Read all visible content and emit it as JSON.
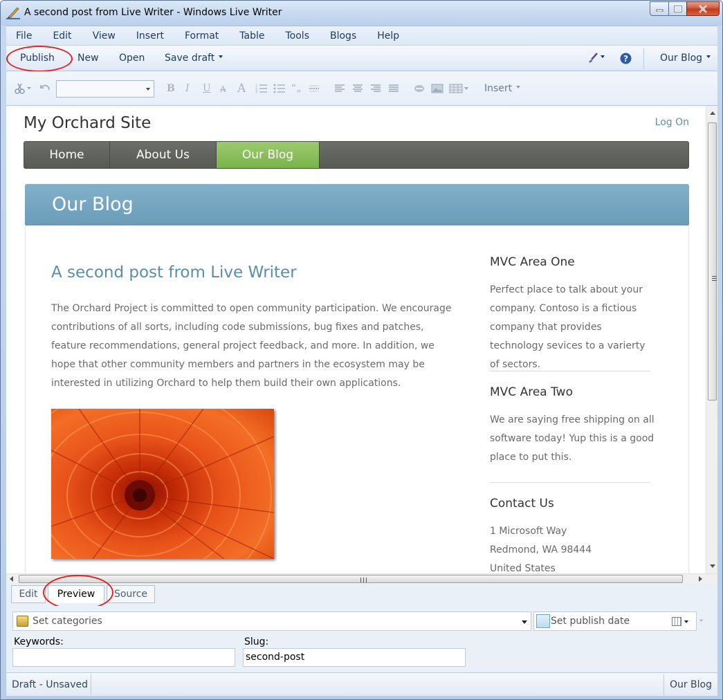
{
  "window": {
    "title": "A second post from Live Writer - Windows Live Writer"
  },
  "menu": {
    "items": [
      "File",
      "Edit",
      "View",
      "Insert",
      "Format",
      "Table",
      "Tools",
      "Blogs",
      "Help"
    ]
  },
  "commands": {
    "publish": "Publish",
    "new": "New",
    "open": "Open",
    "save_draft": "Save draft",
    "blog_selector": "Our Blog"
  },
  "format_toolbar": {
    "insert_label": "Insert",
    "font_value": ""
  },
  "site": {
    "title": "My Orchard Site",
    "log_on": "Log On",
    "nav": [
      {
        "label": "Home",
        "active": false
      },
      {
        "label": "About Us",
        "active": false
      },
      {
        "label": "Our Blog",
        "active": true
      }
    ],
    "banner": "Our Blog"
  },
  "post": {
    "title": "A second post from Live Writer",
    "body": "The Orchard Project is committed to open community participation. We encourage contributions of all sorts, including code submissions, bug fixes and patches, feature recommendations, general project feedback, and more. In addition, we hope that other community members and partners in the ecosystem may be interested in utilizing Orchard to help them build their own applications.",
    "image": "orange chrysanthemum flower"
  },
  "sidebar": [
    {
      "heading": "MVC Area One",
      "text": "Perfect place to talk about your company. Contoso is a fictious company that provides technology sevices to a varierty of sectors."
    },
    {
      "heading": "MVC Area Two",
      "text": "We are saying free shipping on all software today! Yup this is a good place to put this."
    },
    {
      "heading": "Contact Us",
      "lines": [
        "1 Microsoft Way",
        "Redmond, WA 98444",
        "United States"
      ]
    }
  ],
  "view_tabs": [
    {
      "label": "Edit",
      "active": false
    },
    {
      "label": "Preview",
      "active": true
    },
    {
      "label": "Source",
      "active": false
    }
  ],
  "properties": {
    "categories_placeholder": "Set categories",
    "publish_date_placeholder": "Set publish date",
    "keywords_label": "Keywords:",
    "keywords_value": "",
    "slug_label": "Slug:",
    "slug_value": "second-post"
  },
  "status": {
    "left": "Draft - Unsaved",
    "right": "Our Blog"
  },
  "colors": {
    "highlight_ring": "#e4231f",
    "nav_active": "#8cc05c",
    "banner": "#74a6c1",
    "link": "#5a8ea7"
  }
}
